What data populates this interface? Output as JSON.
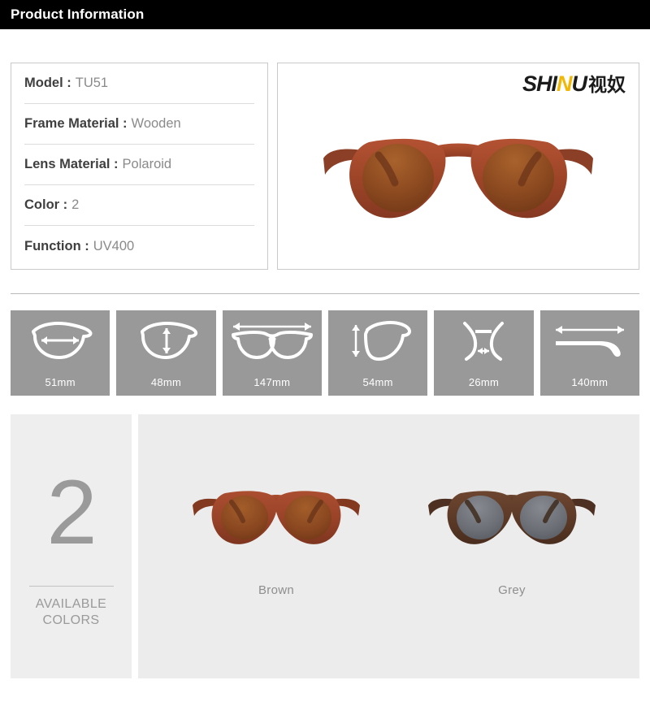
{
  "header": {
    "title": "Product Information"
  },
  "specs": {
    "rows": [
      {
        "label": "Model :",
        "value": "TU51"
      },
      {
        "label": "Frame Material :",
        "value": "Wooden"
      },
      {
        "label": "Lens Material :",
        "value": "Polaroid"
      },
      {
        "label": "Color :",
        "value": "2"
      },
      {
        "label": "Function :",
        "value": "UV400"
      }
    ]
  },
  "brand": {
    "name_part1": "SHI",
    "name_accent": "N",
    "name_part2": "U",
    "name_cn": "视奴",
    "accent_color": "#f2b705"
  },
  "hero": {
    "alt": "wooden-sunglasses-front-view",
    "frame_color": "#a5462c",
    "lens_color": "#8d4a22"
  },
  "measurements": [
    {
      "label": "51mm",
      "icon": "lens-width-icon"
    },
    {
      "label": "48mm",
      "icon": "lens-height-icon"
    },
    {
      "label": "147mm",
      "icon": "frame-width-icon"
    },
    {
      "label": "54mm",
      "icon": "lens-vertical-icon"
    },
    {
      "label": "26mm",
      "icon": "bridge-width-icon"
    },
    {
      "label": "140mm",
      "icon": "temple-length-icon"
    }
  ],
  "colors": {
    "count": "2",
    "caption_line1": "AVAILABLE",
    "caption_line2": "COLORS",
    "variants": [
      {
        "label": "Brown",
        "frame_color": "#9e442b",
        "lens_color": "#8e431d"
      },
      {
        "label": "Grey",
        "frame_color": "#5b3a2a",
        "lens_color": "#6e7278"
      }
    ]
  }
}
